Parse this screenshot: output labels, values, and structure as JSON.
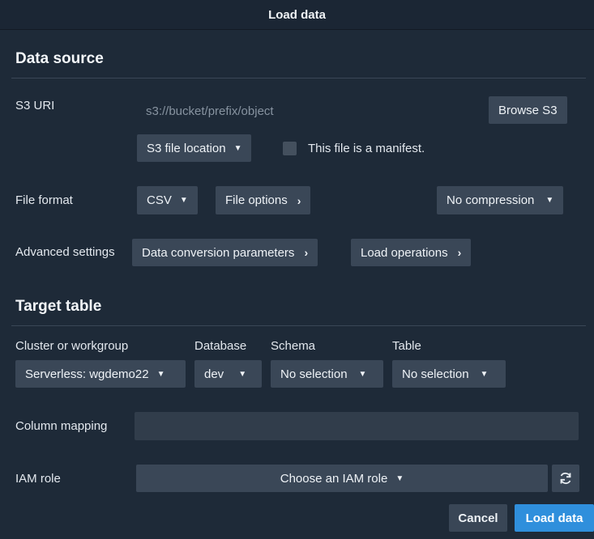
{
  "window": {
    "title": "Load data"
  },
  "data_source": {
    "section_title": "Data source",
    "s3_uri_label": "S3 URI",
    "s3_uri_placeholder": "s3://bucket/prefix/object",
    "browse_s3_label": "Browse S3",
    "file_location_label": "S3 file location",
    "manifest_label": "This file is a manifest.",
    "manifest_checked": false,
    "file_format_label": "File format",
    "file_format_value": "CSV",
    "file_options_label": "File options",
    "compression_value": "No compression",
    "advanced_settings_label": "Advanced settings",
    "data_conversion_label": "Data conversion parameters",
    "load_operations_label": "Load operations"
  },
  "target_table": {
    "section_title": "Target table",
    "cluster_label": "Cluster or workgroup",
    "cluster_value": "Serverless: wgdemo22",
    "database_label": "Database",
    "database_value": "dev",
    "schema_label": "Schema",
    "schema_value": "No selection",
    "table_label": "Table",
    "table_value": "No selection",
    "column_mapping_label": "Column mapping",
    "iam_role_label": "IAM role",
    "iam_role_value": "Choose an IAM role"
  },
  "footer": {
    "cancel_label": "Cancel",
    "load_label": "Load data"
  },
  "icons": {
    "caret": "caret-down-icon",
    "chevron": "chevron-right-icon",
    "refresh": "refresh-icon"
  },
  "colors": {
    "background": "#1e2a38",
    "control": "#3a4757",
    "primary": "#2f8fdc"
  }
}
